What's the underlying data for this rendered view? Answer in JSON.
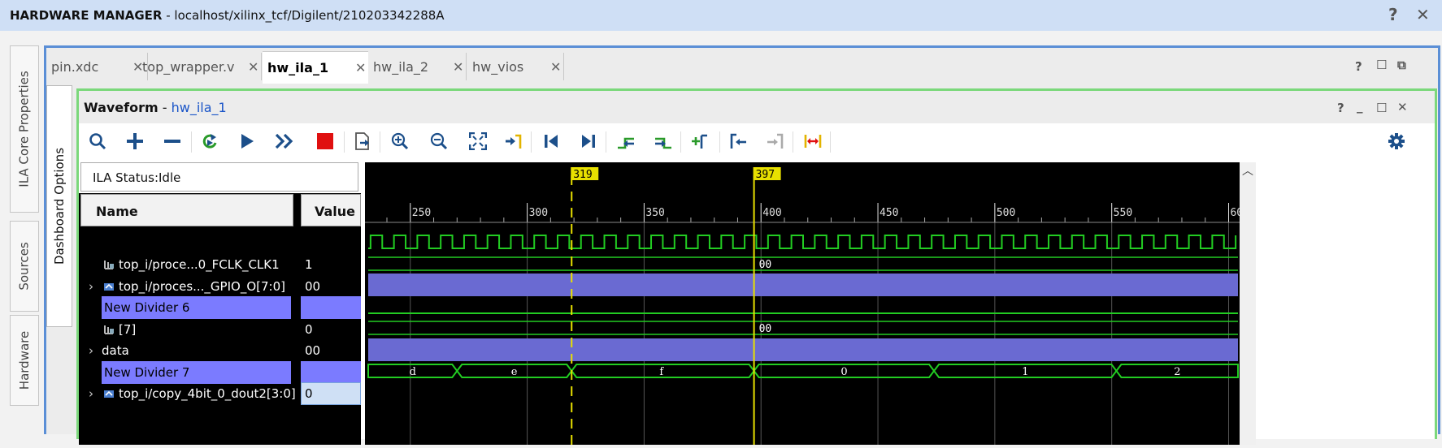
{
  "window": {
    "title_bold": "HARDWARE MANAGER",
    "title_rest": " - localhost/xilinx_tcf/Digilent/210203342288A",
    "help_glyph": "?",
    "close_glyph": "✕"
  },
  "left_tabs": [
    "ILA Core Properties",
    "Sources",
    "Hardware"
  ],
  "dashboard_tab": "Dashboard Options",
  "editor_tabs": [
    {
      "label": "pin.xdc"
    },
    {
      "label": "top_wrapper.v"
    },
    {
      "label": "hw_ila_1",
      "active": true
    },
    {
      "label": "hw_ila_2"
    },
    {
      "label": "hw_vios"
    }
  ],
  "waveform": {
    "title": "Waveform",
    "sep": " - ",
    "link": "hw_ila_1",
    "status": "ILA Status:Idle",
    "name_header": "Name",
    "value_header": "Value",
    "signals": [
      {
        "name": "top_i/proce...0_FCLK_CLK1",
        "value": "1",
        "kind": "bit",
        "expand": false
      },
      {
        "name": "top_i/proces..._GPIO_O[7:0]",
        "value": "00",
        "kind": "bus",
        "expand": true
      },
      {
        "name": "New Divider 6",
        "value": "",
        "kind": "divider",
        "expand": false
      },
      {
        "name": "[7]",
        "value": "0",
        "kind": "bit",
        "expand": false
      },
      {
        "name": "data",
        "value": "00",
        "kind": "plain",
        "expand": true
      },
      {
        "name": "New Divider 7",
        "value": "",
        "kind": "divider",
        "expand": false
      },
      {
        "name": "top_i/copy_4bit_0_dout2[3:0]",
        "value": "0",
        "kind": "bus2",
        "expand": true
      }
    ],
    "axis": {
      "start": 232,
      "end": 604,
      "ticks": [
        "250",
        "300",
        "350",
        "400",
        "450",
        "500",
        "550",
        "60"
      ]
    },
    "markers": [
      {
        "label": "319",
        "pos": 319,
        "style": "dashed"
      },
      {
        "label": "397",
        "pos": 397,
        "style": "solid"
      }
    ],
    "bus_texts": {
      "gpio": "00",
      "data": "00",
      "dout_segments": [
        {
          "from": 232,
          "to": 270,
          "label": "d"
        },
        {
          "from": 270,
          "to": 319,
          "label": "e"
        },
        {
          "from": 319,
          "to": 397,
          "label": "f"
        },
        {
          "from": 397,
          "to": 474,
          "label": "0"
        },
        {
          "from": 474,
          "to": 552,
          "label": "1"
        },
        {
          "from": 552,
          "to": 604,
          "label": "2"
        }
      ]
    },
    "clock_period": 10.0
  },
  "colors": {
    "wave_green": "#22cc22",
    "divider_purple": "#6a6ad2",
    "marker_yellow": "#e8e000",
    "panel_blue": "#5b8fd6",
    "panel_green": "#7bd87b"
  },
  "toolbar_icons": [
    "search-icon",
    "plus-icon",
    "minus-icon",
    "auto-run-icon",
    "run-trigger-icon",
    "run-immediate-icon",
    "stop-icon",
    "export-icon",
    "zoom-in-icon",
    "zoom-out-icon",
    "zoom-fit-icon",
    "goto-cursor-icon",
    "goto-start-icon",
    "goto-end-icon",
    "previous-transition-icon",
    "next-transition-icon",
    "add-marker-icon",
    "previous-marker-icon",
    "next-marker-icon",
    "swap-cursors-icon",
    "settings-icon"
  ]
}
